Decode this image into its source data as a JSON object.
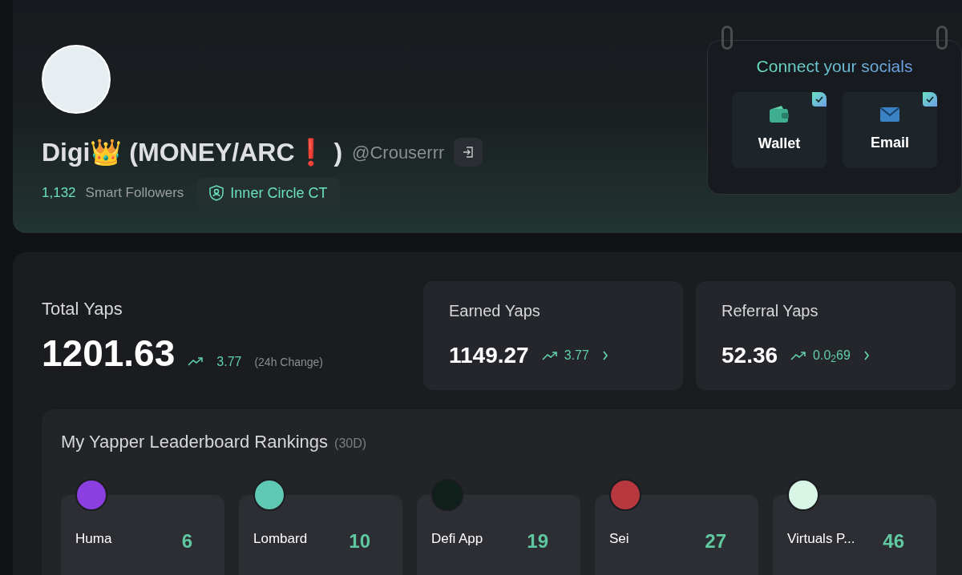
{
  "profile": {
    "name": "Digi👑 (MONEY/ARC❗ )",
    "handle": "@Crouserrr",
    "followers_count": "1,132",
    "followers_label": "Smart Followers",
    "badge": "Inner Circle CT"
  },
  "socials": {
    "title": "Connect your socials",
    "items": [
      {
        "kind": "wallet",
        "label": "Wallet",
        "connected": true
      },
      {
        "kind": "email",
        "label": "Email",
        "connected": true
      }
    ]
  },
  "total": {
    "label": "Total Yaps",
    "value": "1201.63",
    "change": "3.77",
    "change_note": "(24h Change)"
  },
  "cards": [
    {
      "label": "Earned Yaps",
      "value": "1149.27",
      "change": "3.77"
    },
    {
      "label": "Referral Yaps",
      "value": "52.36",
      "change": "0.0$_{2}$69"
    }
  ],
  "leaderboard": {
    "title": "My Yapper Leaderboard Rankings",
    "period": "(30D)",
    "items": [
      {
        "name": "Huma",
        "rank": "6",
        "color": "#8b3fe0"
      },
      {
        "name": "Lombard",
        "rank": "10",
        "color": "#5ec8b3"
      },
      {
        "name": "Defi App",
        "rank": "19",
        "color": "#0f1f1a"
      },
      {
        "name": "Sei",
        "rank": "27",
        "color": "#b8383f"
      },
      {
        "name": "Virtuals P...",
        "rank": "46",
        "color": "#d8f5e6"
      }
    ]
  }
}
